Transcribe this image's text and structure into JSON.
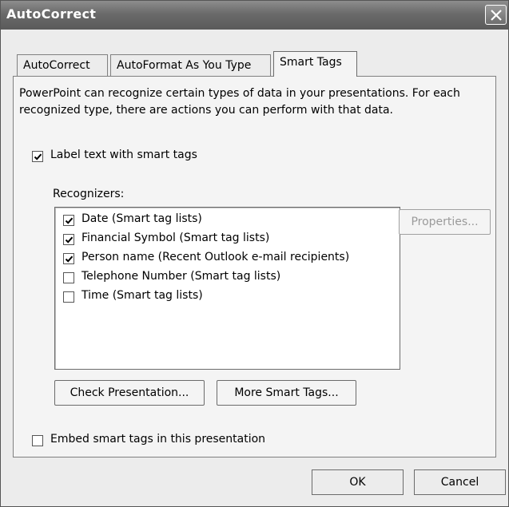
{
  "window": {
    "title": "AutoCorrect"
  },
  "tabs": [
    {
      "label": "AutoCorrect",
      "active": false
    },
    {
      "label": "AutoFormat As You Type",
      "active": false
    },
    {
      "label": "Smart Tags",
      "active": true
    }
  ],
  "panel": {
    "description": "PowerPoint can recognize certain types of data in your presentations. For each recognized type, there are actions you can perform with that data.",
    "label_checkbox": {
      "label": "Label text with smart tags",
      "checked": true
    },
    "recognizers_label": "Recognizers:",
    "recognizers": [
      {
        "label": "Date (Smart tag lists)",
        "checked": true
      },
      {
        "label": "Financial Symbol (Smart tag lists)",
        "checked": true
      },
      {
        "label": "Person name (Recent Outlook e-mail recipients)",
        "checked": true
      },
      {
        "label": "Telephone Number (Smart tag lists)",
        "checked": false
      },
      {
        "label": "Time (Smart tag lists)",
        "checked": false
      }
    ],
    "properties_button": "Properties...",
    "check_presentation_button": "Check Presentation...",
    "more_smart_tags_button": "More Smart Tags...",
    "embed_checkbox": {
      "label": "Embed smart tags in this presentation",
      "checked": false
    }
  },
  "footer": {
    "ok_button": "OK",
    "cancel_button": "Cancel"
  }
}
